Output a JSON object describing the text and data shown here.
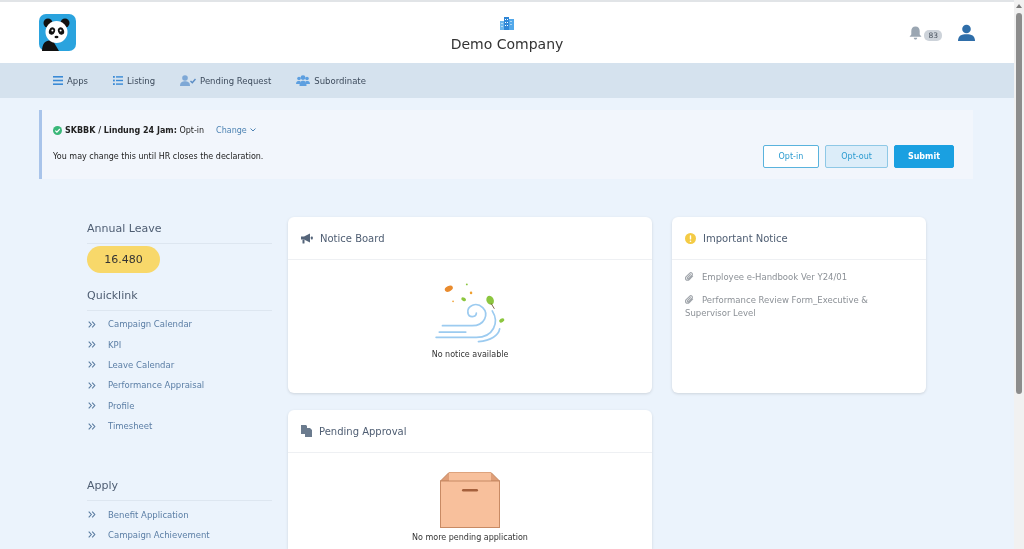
{
  "header": {
    "company_name": "Demo Company",
    "notification_count": "83"
  },
  "nav": [
    {
      "kind": "apps",
      "label": "Apps"
    },
    {
      "kind": "listing",
      "label": "Listing"
    },
    {
      "kind": "pending_request",
      "label": "Pending Request"
    },
    {
      "kind": "subordinate",
      "label": "Subordinate"
    }
  ],
  "declaration": {
    "status": "**SKBBK / Lindung 24 Jam:** Opt-in",
    "change_link": "Change",
    "message": "You may change this until HR closes the declaration.",
    "buttons": [
      {
        "kind": "outline",
        "label": "Opt-in",
        "hovered": false
      },
      {
        "kind": "outline",
        "label": "Opt-out",
        "hovered": true
      },
      {
        "kind": "primary",
        "label": "Submit",
        "hovered": false
      }
    ]
  },
  "sidebar": {
    "annual_leave": {
      "title": "Annual Leave",
      "balance": "16.480"
    },
    "sections": [
      {
        "title": "Quicklink",
        "links": [
          "Campaign Calendar",
          "KPI",
          "Leave Calendar",
          "Performance Appraisal",
          "Profile",
          "Timesheet"
        ]
      },
      {
        "title": "Apply",
        "links": [
          "Benefit Application",
          "Campaign Achievement"
        ]
      }
    ]
  },
  "cards": [
    {
      "kind": "notice_board",
      "title": "Notice Board",
      "empty_message": "No notice available"
    },
    {
      "kind": "important_notice",
      "title": "Important Notice",
      "items": [
        "Employee e-Handbook Ver Y24/01",
        "Performance Review Form_Executive & Supervisor Level"
      ]
    },
    {
      "kind": "pending_approval",
      "title": "Pending Approval",
      "empty_message": "No more pending application"
    }
  ]
}
